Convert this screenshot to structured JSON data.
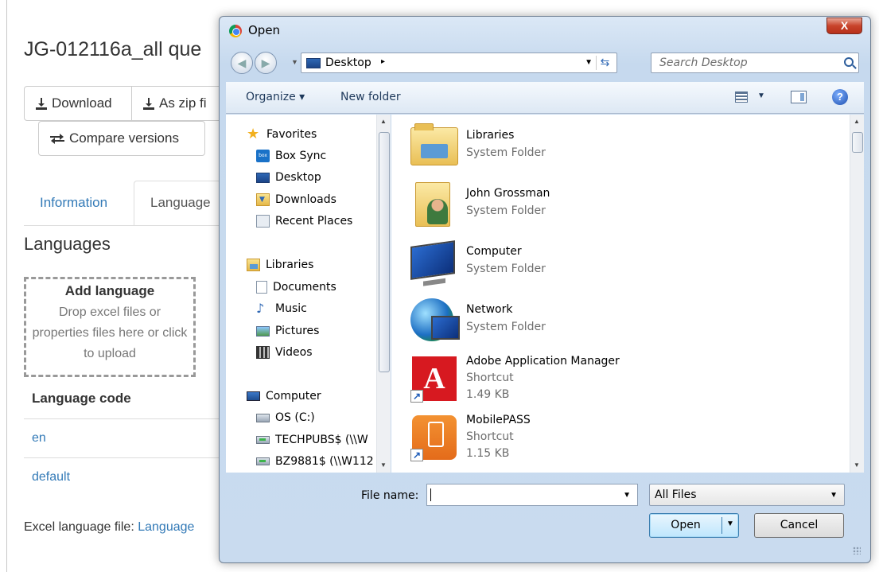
{
  "page": {
    "title": "JG-012116a_all que",
    "buttons": {
      "download": "Download",
      "zip": "As zip fi",
      "compare": "Compare versions"
    },
    "tabs": {
      "information": "Information",
      "languages": "Language"
    },
    "section_title": "Languages",
    "dropzone": {
      "title": "Add language",
      "text": "Drop excel files or properties files here or click to upload"
    },
    "table": {
      "header": "Language code",
      "rows": [
        "en",
        "default"
      ]
    },
    "excel_label": "Excel language file:",
    "excel_link": "Language"
  },
  "dialog": {
    "title": "Open",
    "close_label": "X",
    "address": {
      "current": "Desktop",
      "separator": "▸"
    },
    "search_placeholder": "Search Desktop",
    "toolbar": {
      "organize": "Organize ▾",
      "new_folder": "New folder"
    },
    "nav": {
      "favorites": {
        "label": "Favorites",
        "items": [
          "Box Sync",
          "Desktop",
          "Downloads",
          "Recent Places"
        ]
      },
      "libraries": {
        "label": "Libraries",
        "items": [
          "Documents",
          "Music",
          "Pictures",
          "Videos"
        ]
      },
      "computer": {
        "label": "Computer",
        "items": [
          "OS (C:)",
          "TECHPUBS$ (\\\\W",
          "BZ9881$ (\\\\W112"
        ]
      }
    },
    "files": [
      {
        "name": "Libraries",
        "type": "System Folder",
        "size": "",
        "icon": "libraries-folder-icon"
      },
      {
        "name": "John Grossman",
        "type": "System Folder",
        "size": "",
        "icon": "user-folder-icon"
      },
      {
        "name": "Computer",
        "type": "System Folder",
        "size": "",
        "icon": "computer-icon"
      },
      {
        "name": "Network",
        "type": "System Folder",
        "size": "",
        "icon": "network-icon"
      },
      {
        "name": "Adobe Application Manager",
        "type": "Shortcut",
        "size": "1.49 KB",
        "icon": "adobe-icon"
      },
      {
        "name": "MobilePASS",
        "type": "Shortcut",
        "size": "1.15 KB",
        "icon": "mobilepass-icon"
      }
    ],
    "file_name_label": "File name:",
    "file_name_value": "",
    "file_type": "All Files",
    "open_label": "Open",
    "cancel_label": "Cancel"
  }
}
